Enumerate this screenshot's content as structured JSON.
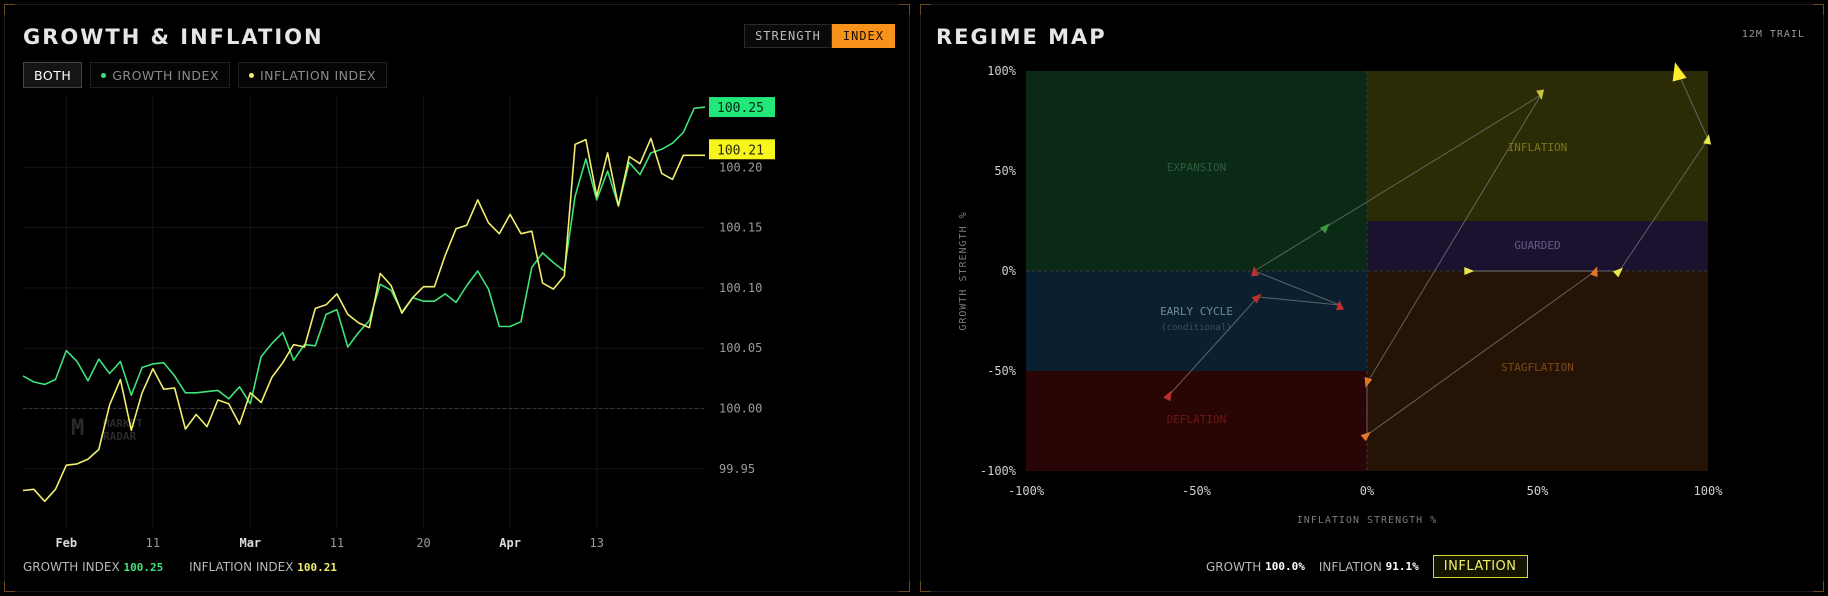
{
  "left": {
    "title": "GROWTH & INFLATION",
    "toggle": {
      "strength": "STRENGTH",
      "index": "INDEX",
      "active": "index"
    },
    "series_tabs": {
      "both": "BOTH",
      "growth": "GROWTH INDEX",
      "inflation": "INFLATION INDEX",
      "active": "both"
    },
    "watermark": {
      "line1": "MARKET",
      "line2": "RADAR"
    },
    "footer": {
      "growth_label": "GROWTH INDEX",
      "growth_value": "100.25",
      "inflation_label": "INFLATION INDEX",
      "inflation_value": "100.21"
    },
    "last_labels": {
      "growth": "100.25",
      "inflation": "100.21"
    }
  },
  "right": {
    "title": "REGIME MAP",
    "trail": "12M TRAIL",
    "footer": {
      "growth_label": "GROWTH",
      "growth_value": "100.0%",
      "inflation_label": "INFLATION",
      "inflation_value": "91.1%",
      "regime": "INFLATION"
    }
  },
  "colors": {
    "growth": "#3ee27a",
    "inflation": "#f2ee6e",
    "accent": "#f7931a",
    "expansion": "#0a2a16",
    "inflation_zone": "#2b2b05",
    "guarded": "#1b1230",
    "early_cycle": "#0a2030",
    "stagflation": "#251405",
    "deflation": "#2a0505"
  },
  "chart_data": [
    {
      "type": "line",
      "title": "GROWTH & INFLATION",
      "xlabel": "",
      "ylabel": "",
      "x_ticks": [
        "Feb",
        "11",
        "Mar",
        "11",
        "20",
        "Apr",
        "13"
      ],
      "x_tick_positions": [
        4,
        12,
        21,
        29,
        37,
        45,
        53
      ],
      "y_ticks": [
        99.95,
        100.0,
        100.05,
        100.1,
        100.15,
        100.2
      ],
      "ylim": [
        99.91,
        100.26
      ],
      "n_points": 64,
      "grid": true,
      "series": [
        {
          "name": "GROWTH INDEX",
          "values": [
            100.027,
            100.022,
            100.02,
            100.024,
            100.048,
            100.039,
            100.023,
            100.041,
            100.029,
            100.039,
            100.011,
            100.034,
            100.037,
            100.038,
            100.027,
            100.013,
            100.013,
            100.014,
            100.015,
            100.008,
            100.018,
            100.004,
            100.043,
            100.054,
            100.063,
            100.04,
            100.053,
            100.052,
            100.078,
            100.082,
            100.051,
            100.063,
            100.073,
            100.103,
            100.098,
            100.08,
            100.092,
            100.089,
            100.089,
            100.095,
            100.088,
            100.102,
            100.114,
            100.099,
            100.068,
            100.068,
            100.072,
            100.117,
            100.129,
            100.121,
            100.114,
            100.176,
            100.207,
            100.173,
            100.197,
            100.168,
            100.204,
            100.194,
            100.212,
            100.215,
            100.22,
            100.229,
            100.249,
            100.25
          ]
        },
        {
          "name": "INFLATION INDEX",
          "values": [
            99.932,
            99.933,
            99.923,
            99.933,
            99.953,
            99.954,
            99.958,
            99.966,
            100.003,
            100.024,
            99.982,
            100.013,
            100.033,
            100.016,
            100.017,
            99.983,
            99.995,
            99.985,
            100.007,
            100.004,
            99.987,
            100.013,
            100.005,
            100.026,
            100.038,
            100.053,
            100.051,
            100.083,
            100.086,
            100.095,
            100.078,
            100.071,
            100.067,
            100.112,
            100.102,
            100.079,
            100.092,
            100.101,
            100.101,
            100.127,
            100.149,
            100.152,
            100.173,
            100.154,
            100.145,
            100.161,
            100.145,
            100.147,
            100.104,
            100.099,
            100.11,
            100.219,
            100.223,
            100.176,
            100.212,
            100.168,
            100.209,
            100.203,
            100.224,
            100.195,
            100.19,
            100.21,
            100.21,
            100.21
          ]
        }
      ]
    },
    {
      "type": "scatter",
      "title": "REGIME MAP",
      "xlabel": "INFLATION STRENGTH %",
      "ylabel": "GROWTH STRENGTH %",
      "xlim": [
        -100,
        100
      ],
      "ylim": [
        -100,
        100
      ],
      "x_ticks": [
        "-100%",
        "-50%",
        "0%",
        "50%",
        "100%"
      ],
      "y_ticks": [
        "100%",
        "50%",
        "0%",
        "-50%",
        "-100%"
      ],
      "regions": [
        {
          "name": "EXPANSION",
          "x": [
            -100,
            0
          ],
          "y": [
            0,
            100
          ]
        },
        {
          "name": "INFLATION",
          "x": [
            0,
            100
          ],
          "y": [
            25,
            100
          ]
        },
        {
          "name": "GUARDED",
          "x": [
            0,
            100
          ],
          "y": [
            0,
            25
          ]
        },
        {
          "name": "EARLY CYCLE",
          "sub": "(conditional)",
          "x": [
            -100,
            0
          ],
          "y": [
            -50,
            0
          ]
        },
        {
          "name": "STAGFLATION",
          "x": [
            0,
            100
          ],
          "y": [
            -100,
            0
          ]
        },
        {
          "name": "DEFLATION",
          "x": [
            -100,
            0
          ],
          "y": [
            -100,
            -50
          ]
        }
      ],
      "trail": [
        {
          "x": -58,
          "y": -62,
          "color": "#c0302a"
        },
        {
          "x": -32,
          "y": -13,
          "color": "#c0302a"
        },
        {
          "x": -8,
          "y": -17,
          "color": "#c0302a"
        },
        {
          "x": -33,
          "y": 0,
          "color": "#c0302a"
        },
        {
          "x": -12,
          "y": 22,
          "color": "#3a9a3a"
        },
        {
          "x": 51,
          "y": 88,
          "color": "#c7c33e"
        },
        {
          "x": 0,
          "y": -56,
          "color": "#e0782a"
        },
        {
          "x": 0,
          "y": -82,
          "color": "#e0782a"
        },
        {
          "x": 67,
          "y": 0,
          "color": "#e0782a"
        },
        {
          "x": 30,
          "y": 0,
          "color": "#e8e84a"
        },
        {
          "x": 74,
          "y": 0,
          "color": "#e8e84a"
        },
        {
          "x": 100,
          "y": 66,
          "color": "#e8e84a"
        },
        {
          "x": 91,
          "y": 100,
          "color": "#ffee2a"
        }
      ]
    }
  ]
}
